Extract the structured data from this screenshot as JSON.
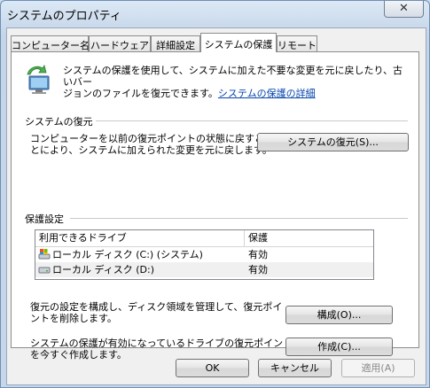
{
  "window": {
    "title": "システムのプロパティ",
    "close_symbol": "✕"
  },
  "tabs": [
    {
      "label": "コンピューター名",
      "active": false
    },
    {
      "label": "ハードウェア",
      "active": false
    },
    {
      "label": "詳細設定",
      "active": false
    },
    {
      "label": "システムの保護",
      "active": true
    },
    {
      "label": "リモート",
      "active": false
    }
  ],
  "intro": {
    "line1": "システムの保護を使用して、システムに加えた不要な変更を元に戻したり、古いバー",
    "line2_prefix": "ジョンのファイルを復元できます。",
    "link": "システムの保護の詳細"
  },
  "restore": {
    "heading": "システムの復元",
    "line1": "コンピューターを以前の復元ポイントの状態に戻すこ",
    "line2": "とにより、システムに加えられた変更を元に戻します。",
    "button": "システムの復元(S)..."
  },
  "protection": {
    "heading": "保護設定",
    "columns": [
      "利用できるドライブ",
      "保護"
    ],
    "drives": [
      {
        "name": "ローカル ディスク (C:) (システム)",
        "status": "有効",
        "icon": "system-drive-icon"
      },
      {
        "name": "ローカル ディスク (D:)",
        "status": "有効",
        "icon": "drive-icon"
      }
    ],
    "configure_line1": "復元の設定を構成し、ディスク領域を管理して、復元ポイ",
    "configure_line2": "ントを削除します。",
    "configure_button": "構成(O)...",
    "create_line1": "システムの保護が有効になっているドライブの復元ポイント",
    "create_line2": "を今すぐ作成します。",
    "create_button": "作成(C)..."
  },
  "footer": {
    "ok": "OK",
    "cancel": "キャンセル",
    "apply": "適用(A)"
  }
}
